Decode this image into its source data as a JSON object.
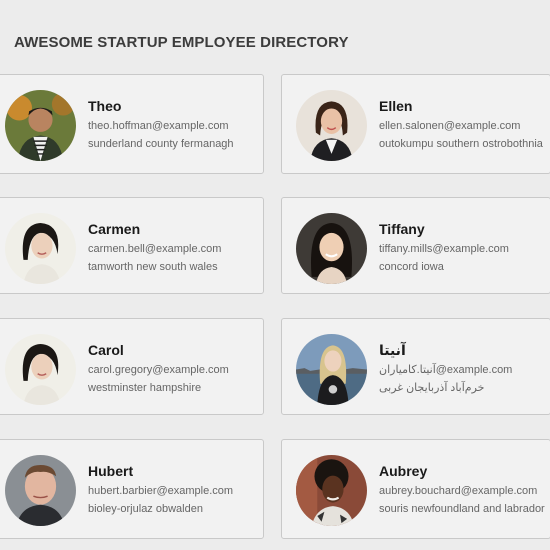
{
  "page_title": "AWESOME STARTUP EMPLOYEE DIRECTORY",
  "employees": [
    {
      "name": "Theo",
      "email": "theo.hoffman@example.com",
      "location": "sunderland county fermanagh"
    },
    {
      "name": "Ellen",
      "email": "ellen.salonen@example.com",
      "location": "outokumpu southern ostrobothnia"
    },
    {
      "name": "Carmen",
      "email": "carmen.bell@example.com",
      "location": "tamworth new south wales"
    },
    {
      "name": "Tiffany",
      "email": "tiffany.mills@example.com",
      "location": "concord iowa"
    },
    {
      "name": "Carol",
      "email": "carol.gregory@example.com",
      "location": "westminster hampshire"
    },
    {
      "name": "آنیتا",
      "email": "آنیتا.کامیاران@example.com",
      "location": "خرم‌آباد آذربایجان غربی"
    },
    {
      "name": "Hubert",
      "email": "hubert.barbier@example.com",
      "location": "bioley-orjulaz obwalden"
    },
    {
      "name": "Aubrey",
      "email": "aubrey.bouchard@example.com",
      "location": "souris newfoundland and labrador"
    }
  ],
  "avatar_colors": {
    "theo": "#6b7a3a",
    "ellen": "#e8e2da",
    "carmen": "#f0efe8",
    "tiffany": "#3e3a36",
    "carol": "#f0efe8",
    "anita": "#6f8aa6",
    "hubert": "#8a8f94",
    "aubrey": "#8a4a38"
  }
}
